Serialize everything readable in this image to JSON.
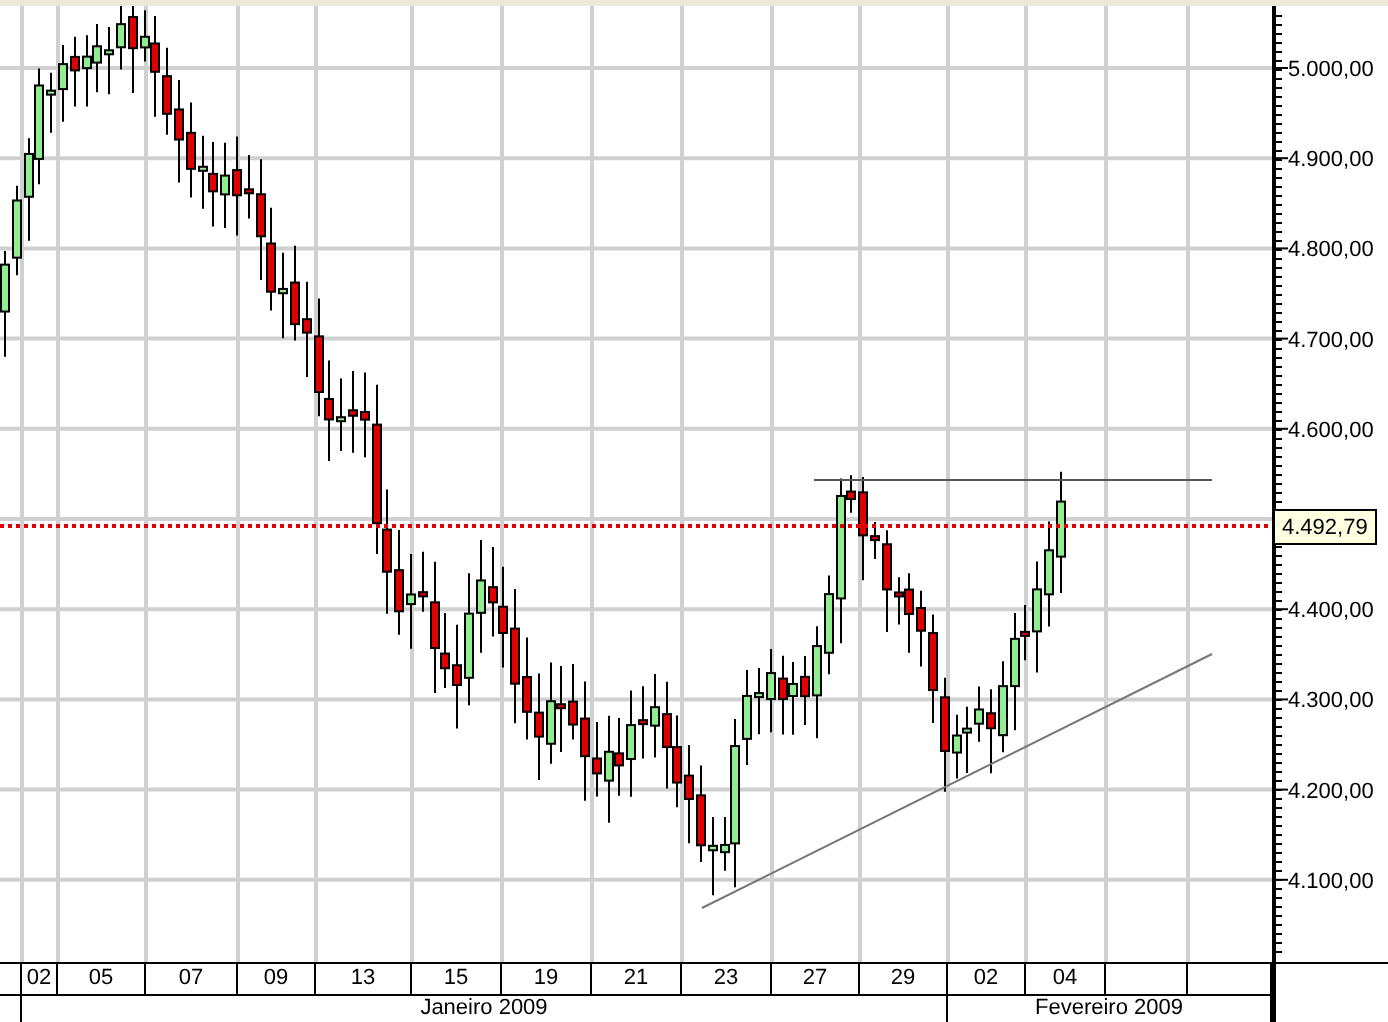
{
  "price_axis": {
    "ticks": [
      "5.000,00",
      "4.900,00",
      "4.800,00",
      "4.700,00",
      "4.600,00",
      "4.400,00",
      "4.300,00",
      "4.200,00",
      "4.100,00"
    ]
  },
  "last_price": "4.492,79",
  "date_axis": {
    "days": [
      "02",
      "05",
      "07",
      "09",
      "13",
      "15",
      "19",
      "21",
      "23",
      "27",
      "29",
      "02",
      "04"
    ],
    "months": [
      "Janeiro 2009",
      "Fevereiro 2009"
    ]
  }
}
